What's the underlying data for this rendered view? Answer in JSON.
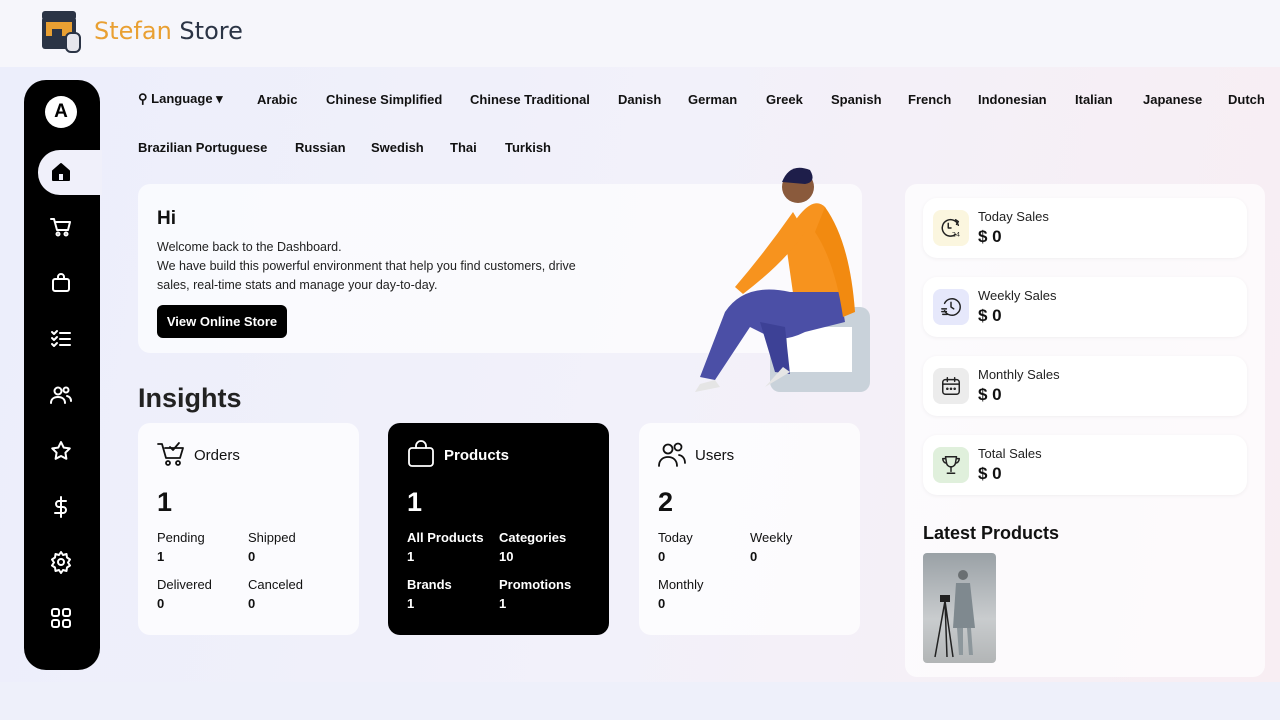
{
  "brand": {
    "part1": "Stefan",
    "part2": "Store"
  },
  "sidebar": {
    "avatar": "A",
    "items": [
      "home",
      "cart",
      "bag",
      "checklist",
      "users",
      "star",
      "dollar",
      "settings",
      "grid"
    ]
  },
  "language": {
    "label": "Language",
    "options": [
      "Arabic",
      "Chinese Simplified",
      "Chinese Traditional",
      "Danish",
      "German",
      "Greek",
      "Spanish",
      "French",
      "Indonesian",
      "Italian",
      "Japanese",
      "Dutch",
      "Brazilian Portuguese",
      "Russian",
      "Swedish",
      "Thai",
      "Turkish"
    ]
  },
  "welcome": {
    "title": "Hi",
    "line1": "Welcome back to the Dashboard.",
    "line2": "We have build this powerful environment that help you find customers, drive",
    "line3": "sales, real-time stats and manage your day-to-day.",
    "button": "View Online Store"
  },
  "insights": {
    "title": "Insights",
    "orders": {
      "title": "Orders",
      "count": "1",
      "stats": [
        {
          "label": "Pending",
          "value": "1"
        },
        {
          "label": "Shipped",
          "value": "0"
        },
        {
          "label": "Delivered",
          "value": "0"
        },
        {
          "label": "Canceled",
          "value": "0"
        }
      ]
    },
    "products": {
      "title": "Products",
      "count": "1",
      "stats": [
        {
          "label": "All Products",
          "value": "1"
        },
        {
          "label": "Categories",
          "value": "10"
        },
        {
          "label": "Brands",
          "value": "1"
        },
        {
          "label": "Promotions",
          "value": "1"
        }
      ]
    },
    "users": {
      "title": "Users",
      "count": "2",
      "stats": [
        {
          "label": "Today",
          "value": "0"
        },
        {
          "label": "Weekly",
          "value": "0"
        },
        {
          "label": "Monthly",
          "value": "0"
        }
      ]
    }
  },
  "sales": [
    {
      "label": "Today Sales",
      "value": "$ 0",
      "color": "#fbf6df"
    },
    {
      "label": "Weekly Sales",
      "value": "$ 0",
      "color": "#e6e8fb"
    },
    {
      "label": "Monthly Sales",
      "value": "$ 0",
      "color": "#ececec"
    },
    {
      "label": "Total Sales",
      "value": "$ 0",
      "color": "#e0f0dc"
    }
  ],
  "latest_products": {
    "title": "Latest Products"
  }
}
